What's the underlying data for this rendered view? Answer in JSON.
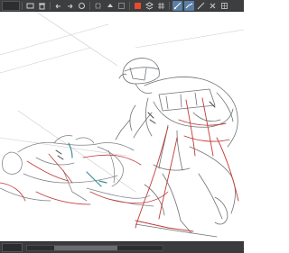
{
  "toolbar": {
    "zoom_value": "",
    "icons": [
      "menu-icon",
      "navigator-icon",
      "undo-icon",
      "redo-icon",
      "clear-icon",
      "transform-icon",
      "fill-icon",
      "select-icon",
      "ruler-icon",
      "snap-ruler-icon",
      "snap-grid-icon",
      "snap-special-icon",
      "settings-icon"
    ]
  },
  "status": {
    "zoom_readout": ""
  },
  "colors": {
    "toolbar_bg": "#3d3e40",
    "active_tool": "#5a7fa8",
    "sketch_gray": "#8a8d92",
    "sketch_red": "#c23a3a",
    "sketch_teal": "#3f8f98"
  }
}
